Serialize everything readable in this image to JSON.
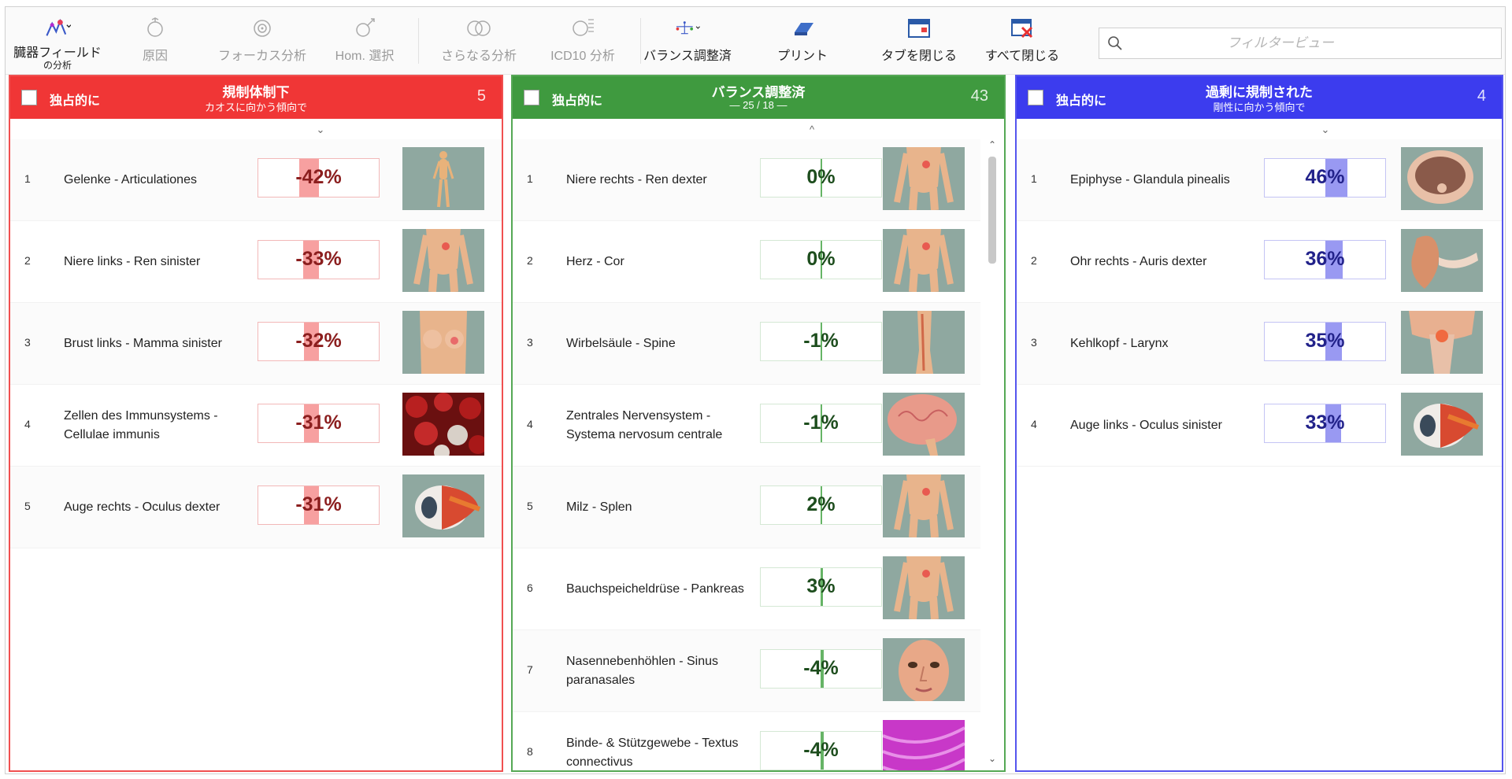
{
  "toolbar": {
    "organ_field": {
      "label": "臓器フィールド",
      "sub": "の分析"
    },
    "cause": {
      "label": "原因"
    },
    "focus": {
      "label": "フォーカス分析"
    },
    "hom": {
      "label": "Hom. 選択"
    },
    "further": {
      "label": "さらなる分析"
    },
    "icd10": {
      "label": "ICD10 分析"
    },
    "balanced": {
      "label": "バランス調整済"
    },
    "print": {
      "label": "プリント"
    },
    "close_tab": {
      "label": "タブを閉じる"
    },
    "close_all": {
      "label": "すべて閉じる"
    },
    "filter_placeholder": "フィルタービュー"
  },
  "panels": {
    "red": {
      "exclusive_label": "独占的に",
      "title": "規制体制下",
      "subtitle": "カオスに向かう傾向で",
      "count": "5",
      "sort": "⌄",
      "items": [
        {
          "idx": "1",
          "name": "Gelenke - Articulationes",
          "value": "-42%",
          "level": -42,
          "thumb": "body"
        },
        {
          "idx": "2",
          "name": "Niere links - Ren sinister",
          "value": "-33%",
          "level": -33,
          "thumb": "torso"
        },
        {
          "idx": "3",
          "name": "Brust links - Mamma sinister",
          "value": "-32%",
          "level": -32,
          "thumb": "chest"
        },
        {
          "idx": "4",
          "name": "Zellen des Immunsystems - Cellulae immunis",
          "value": "-31%",
          "level": -31,
          "thumb": "cells"
        },
        {
          "idx": "5",
          "name": "Auge rechts - Oculus dexter",
          "value": "-31%",
          "level": -31,
          "thumb": "eye"
        }
      ]
    },
    "green": {
      "exclusive_label": "独占的に",
      "title": "バランス調整済",
      "subtitle": "— 25 / 18 —",
      "count": "43",
      "sort": "^",
      "items": [
        {
          "idx": "1",
          "name": "Niere rechts - Ren dexter",
          "value": "0%",
          "level": 0,
          "thumb": "torso"
        },
        {
          "idx": "2",
          "name": "Herz - Cor",
          "value": "0%",
          "level": 0,
          "thumb": "torso"
        },
        {
          "idx": "3",
          "name": "Wirbelsäule - Spine",
          "value": "-1%",
          "level": -1,
          "thumb": "spine"
        },
        {
          "idx": "4",
          "name": "Zentrales Nervensystem - Systema nervosum centrale",
          "value": "-1%",
          "level": -1,
          "thumb": "brain"
        },
        {
          "idx": "5",
          "name": "Milz - Splen",
          "value": "2%",
          "level": 2,
          "thumb": "torso"
        },
        {
          "idx": "6",
          "name": "Bauchspeicheldrüse - Pankreas",
          "value": "3%",
          "level": 3,
          "thumb": "torso"
        },
        {
          "idx": "7",
          "name": "Nasennebenhöhlen - Sinus paranasales",
          "value": "-4%",
          "level": -4,
          "thumb": "face"
        },
        {
          "idx": "8",
          "name": "Binde- & Stützgewebe - Textus connectivus",
          "value": "-4%",
          "level": -4,
          "thumb": "tissue"
        }
      ]
    },
    "blue": {
      "exclusive_label": "独占的に",
      "title": "過剰に規制された",
      "subtitle": "剛性に向かう傾向で",
      "count": "4",
      "sort": "⌄",
      "items": [
        {
          "idx": "1",
          "name": "Epiphyse - Glandula pinealis",
          "value": "46%",
          "level": 46,
          "thumb": "brainside"
        },
        {
          "idx": "2",
          "name": "Ohr rechts - Auris dexter",
          "value": "36%",
          "level": 36,
          "thumb": "ear"
        },
        {
          "idx": "3",
          "name": "Kehlkopf - Larynx",
          "value": "35%",
          "level": 35,
          "thumb": "throat"
        },
        {
          "idx": "4",
          "name": "Auge links - Oculus sinister",
          "value": "33%",
          "level": 33,
          "thumb": "eye"
        }
      ]
    }
  },
  "colors": {
    "red": "#f03636",
    "green": "#3f9a3f",
    "blue": "#3c3cee"
  }
}
